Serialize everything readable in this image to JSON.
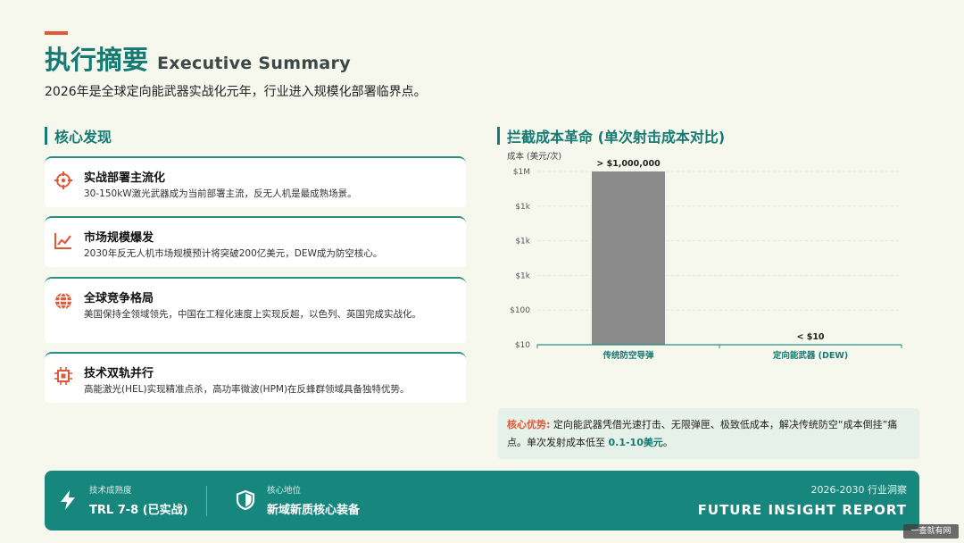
{
  "header": {
    "title_cn": "执行摘要",
    "title_en": "Executive Summary",
    "subtitle": "2026年是全球定向能武器实战化元年，行业进入规模化部署临界点。"
  },
  "findings": {
    "heading": "核心发现",
    "items": [
      {
        "icon": "crosshair-icon",
        "title": "实战部署主流化",
        "desc": "30-150kW激光武器成为当前部署主流，反无人机是最成熟场景。"
      },
      {
        "icon": "trend-line-icon",
        "title": "市场规模爆发",
        "desc": "2030年反无人机市场规模预计将突破200亿美元，DEW成为防空核心。"
      },
      {
        "icon": "globe-icon",
        "title": "全球竞争格局",
        "desc": "美国保持全领域领先，中国在工程化速度上实现反超，以色列、英国完成实战化。"
      },
      {
        "icon": "chip-icon",
        "title": "技术双轨并行",
        "desc": "高能激光(HEL)实现精准点杀，高功率微波(HPM)在反蜂群领域具备独特优势。"
      }
    ]
  },
  "chart_section": {
    "heading": "拦截成本革命 (单次射击成本对比)"
  },
  "chart_data": {
    "type": "bar",
    "ylabel": "成本 (美元/次)",
    "y_scale": "log",
    "y_ticks": [
      "$10",
      "$100",
      "$1k",
      "$1k",
      "$1k",
      "$1M"
    ],
    "categories": [
      "传统防空导弹",
      "定向能武器 (DEW)"
    ],
    "values": [
      1000000,
      10
    ],
    "data_labels": [
      "> $1,000,000",
      "< $10"
    ],
    "colors": {
      "bar": "#8a8a8a",
      "axis": "#2b8d85",
      "category": "#157a72"
    }
  },
  "callout": {
    "label": "核心优势:",
    "text": "定向能武器凭借光速打击、无限弹匣、极致低成本，解决传统防空“成本倒挂”痛点。单次发射成本低至",
    "value": "0.1-10美元",
    "end": "。"
  },
  "footer": {
    "item1": {
      "label": "技术成熟度",
      "value": "TRL 7-8 (已实战)"
    },
    "item2": {
      "label": "核心地位",
      "value": "新域新质核心装备"
    },
    "period": "2026-2030 行业洞察",
    "report": "FUTURE INSIGHT REPORT"
  },
  "watermark": "一查就有网",
  "colors": {
    "accent": "#157a72",
    "highlight": "#e05a3a",
    "background": "#f6f8ee"
  }
}
